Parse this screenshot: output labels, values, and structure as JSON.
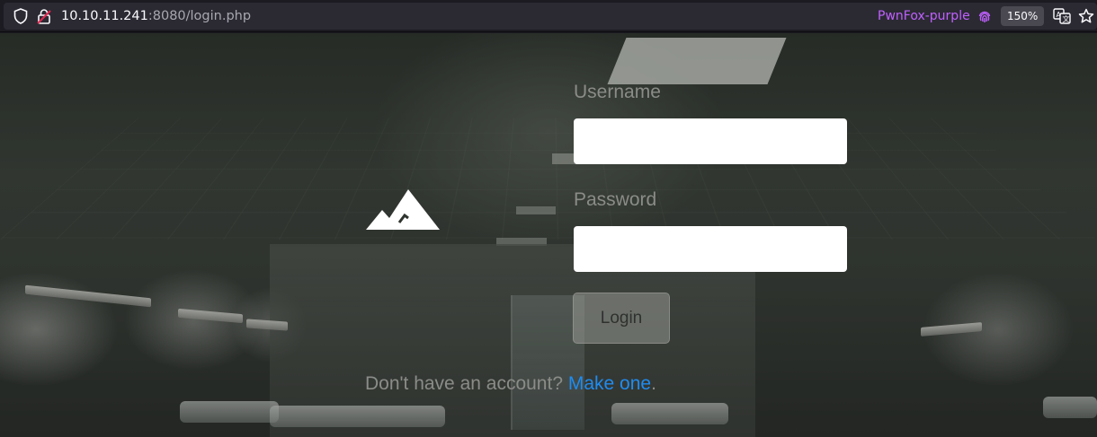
{
  "browser": {
    "url_host": "10.10.11.241",
    "url_rest": ":8080/login.php",
    "container_label": "PwnFox-purple",
    "zoom_level": "150%",
    "icons": [
      "shield-icon",
      "lock-warning-icon",
      "fingerprint-icon",
      "translate-icon",
      "star-icon"
    ],
    "container_color": "#c060ff"
  },
  "login": {
    "logo_icon": "mountain-icon",
    "username_label": "Username",
    "username_value": "",
    "password_label": "Password",
    "password_value": "",
    "login_button": "Login",
    "signup_prompt": "Don't have an account? ",
    "signup_link": "Make one",
    "signup_end": ".",
    "link_color": "#1f8cf0"
  }
}
